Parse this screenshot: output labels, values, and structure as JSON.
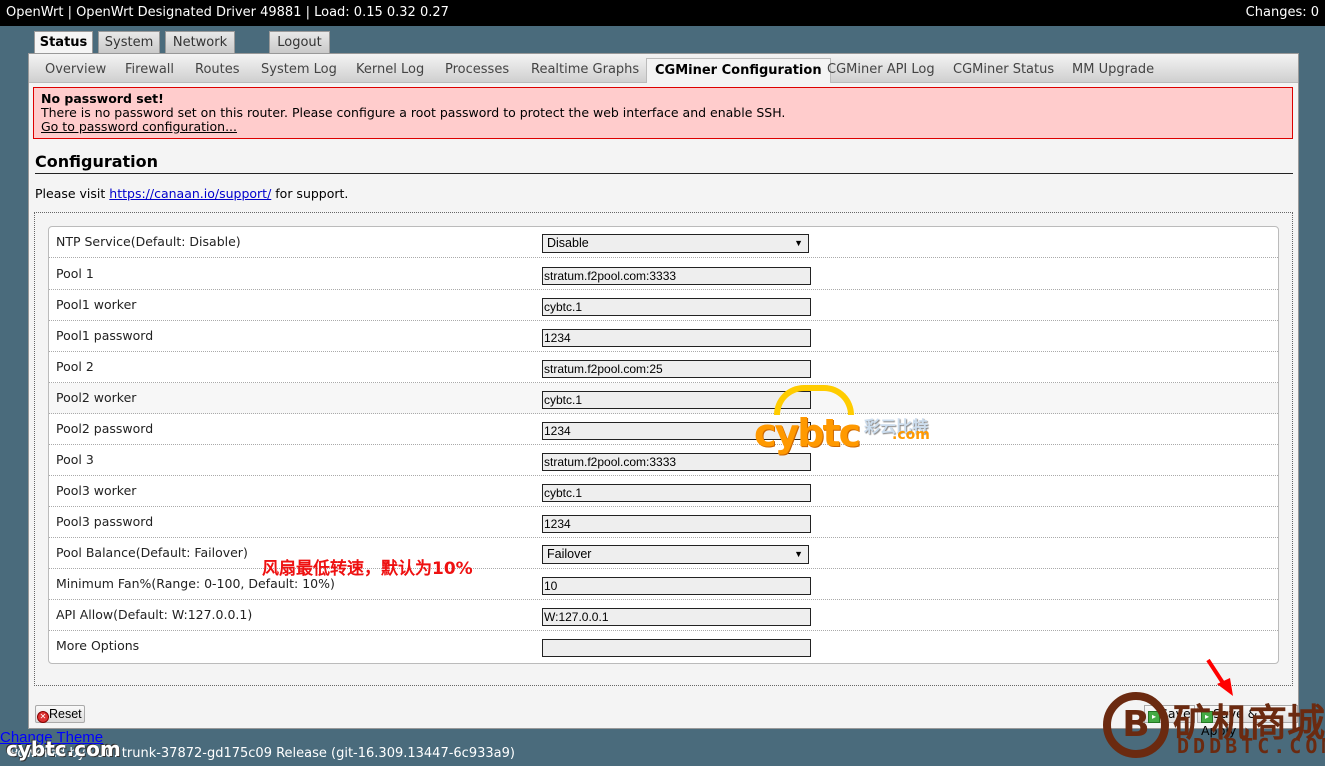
{
  "topbar": {
    "title": "OpenWrt | OpenWrt Designated Driver 49881 | Load: 0.15 0.32 0.27",
    "changes": "Changes: 0"
  },
  "main_tabs": [
    {
      "label": "Status",
      "active": true
    },
    {
      "label": "System",
      "active": false
    },
    {
      "label": "Network",
      "active": false
    },
    {
      "label": "Logout",
      "active": false
    }
  ],
  "sub_tabs": [
    {
      "label": "Overview",
      "active": false
    },
    {
      "label": "Firewall",
      "active": false
    },
    {
      "label": "Routes",
      "active": false
    },
    {
      "label": "System Log",
      "active": false
    },
    {
      "label": "Kernel Log",
      "active": false
    },
    {
      "label": "Processes",
      "active": false
    },
    {
      "label": "Realtime Graphs",
      "active": false
    },
    {
      "label": "CGMiner Configuration",
      "active": true
    },
    {
      "label": "CGMiner API Log",
      "active": false
    },
    {
      "label": "CGMiner Status",
      "active": false
    },
    {
      "label": "MM Upgrade",
      "active": false
    }
  ],
  "alert": {
    "title": "No password set!",
    "message": "There is no password set on this router. Please configure a root password to protect the web interface and enable SSH.",
    "link": "Go to password configuration..."
  },
  "section": {
    "title": "Configuration",
    "support_prefix": "Please visit ",
    "support_link": "https://canaan.io/support/",
    "support_suffix": " for support."
  },
  "form": {
    "rows": [
      {
        "label": "NTP Service(Default: Disable)",
        "type": "select",
        "value": "Disable"
      },
      {
        "label": "Pool 1",
        "type": "text",
        "value": "stratum.f2pool.com:3333"
      },
      {
        "label": "Pool1 worker",
        "type": "text",
        "value": "cybtc.1"
      },
      {
        "label": "Pool1 password",
        "type": "text",
        "value": "1234"
      },
      {
        "label": "Pool 2",
        "type": "text",
        "value": "stratum.f2pool.com:25"
      },
      {
        "label": "Pool2 worker",
        "type": "text",
        "value": "cybtc.1"
      },
      {
        "label": "Pool2 password",
        "type": "text",
        "value": "1234"
      },
      {
        "label": "Pool 3",
        "type": "text",
        "value": "stratum.f2pool.com:3333"
      },
      {
        "label": "Pool3 worker",
        "type": "text",
        "value": "cybtc.1"
      },
      {
        "label": "Pool3 password",
        "type": "text",
        "value": "1234"
      },
      {
        "label": "Pool Balance(Default: Failover)",
        "type": "select",
        "value": "Failover"
      },
      {
        "label": "Minimum Fan%(Range: 0-100, Default: 10%)",
        "type": "text",
        "value": "10"
      },
      {
        "label": "API Allow(Default: W:127.0.0.1)",
        "type": "text",
        "value": "W:127.0.0.1"
      },
      {
        "label": "More Options",
        "type": "text",
        "value": ""
      }
    ]
  },
  "annotation": "风扇最低转速，默认为10%",
  "buttons": {
    "reset": "Reset",
    "save": "Save",
    "save_apply": "Save & Apply"
  },
  "footer": {
    "change_theme": "Change Theme",
    "powered_by": "Powered by LuCI trunk-37872-gd175c09 Release (git-16.309.13447-6c933a9)"
  },
  "watermarks": {
    "cybtc": "cybtc",
    "cybtc_com": ".com",
    "cybtc_cn": "彩云比特",
    "cybtc_small": "cybtc.com",
    "dddbtc_cn": "矿机商城",
    "dddbtc_en": "DDDBTC.COM",
    "dddbtc_coin": "B"
  }
}
